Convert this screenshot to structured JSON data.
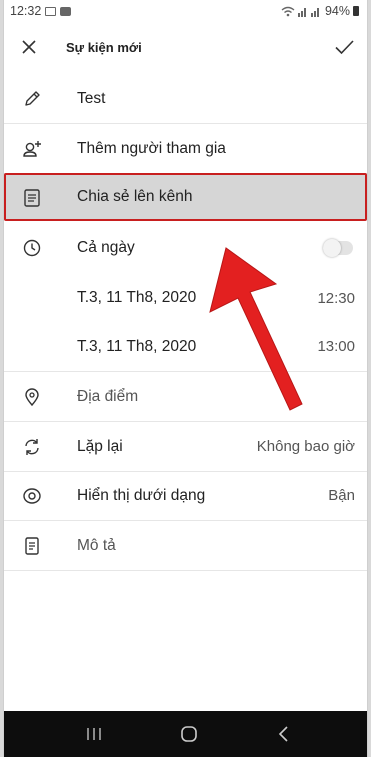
{
  "status_bar": {
    "time": "12:32",
    "battery": "94%"
  },
  "app_bar": {
    "title": "Sự kiện mới",
    "close_icon": "close-icon",
    "confirm_icon": "check-icon"
  },
  "form": {
    "title_value": "Test",
    "add_participants": "Thêm người tham gia",
    "share_to_channel": "Chia sẻ lên kênh",
    "all_day_label": "Cả ngày",
    "all_day_on": false,
    "start_date": "T.3, 11 Th8, 2020",
    "start_time": "12:30",
    "end_date": "T.3, 11 Th8, 2020",
    "end_time": "13:00",
    "location_placeholder": "Địa điểm",
    "repeat_label": "Lặp lại",
    "repeat_value": "Không bao giờ",
    "show_as_label": "Hiển thị dưới dạng",
    "show_as_value": "Bận",
    "description_placeholder": "Mô tả"
  },
  "colors": {
    "highlight_border": "#c81f1f",
    "arrow": "#e32020",
    "nav_bar": "#0d0d0d"
  }
}
